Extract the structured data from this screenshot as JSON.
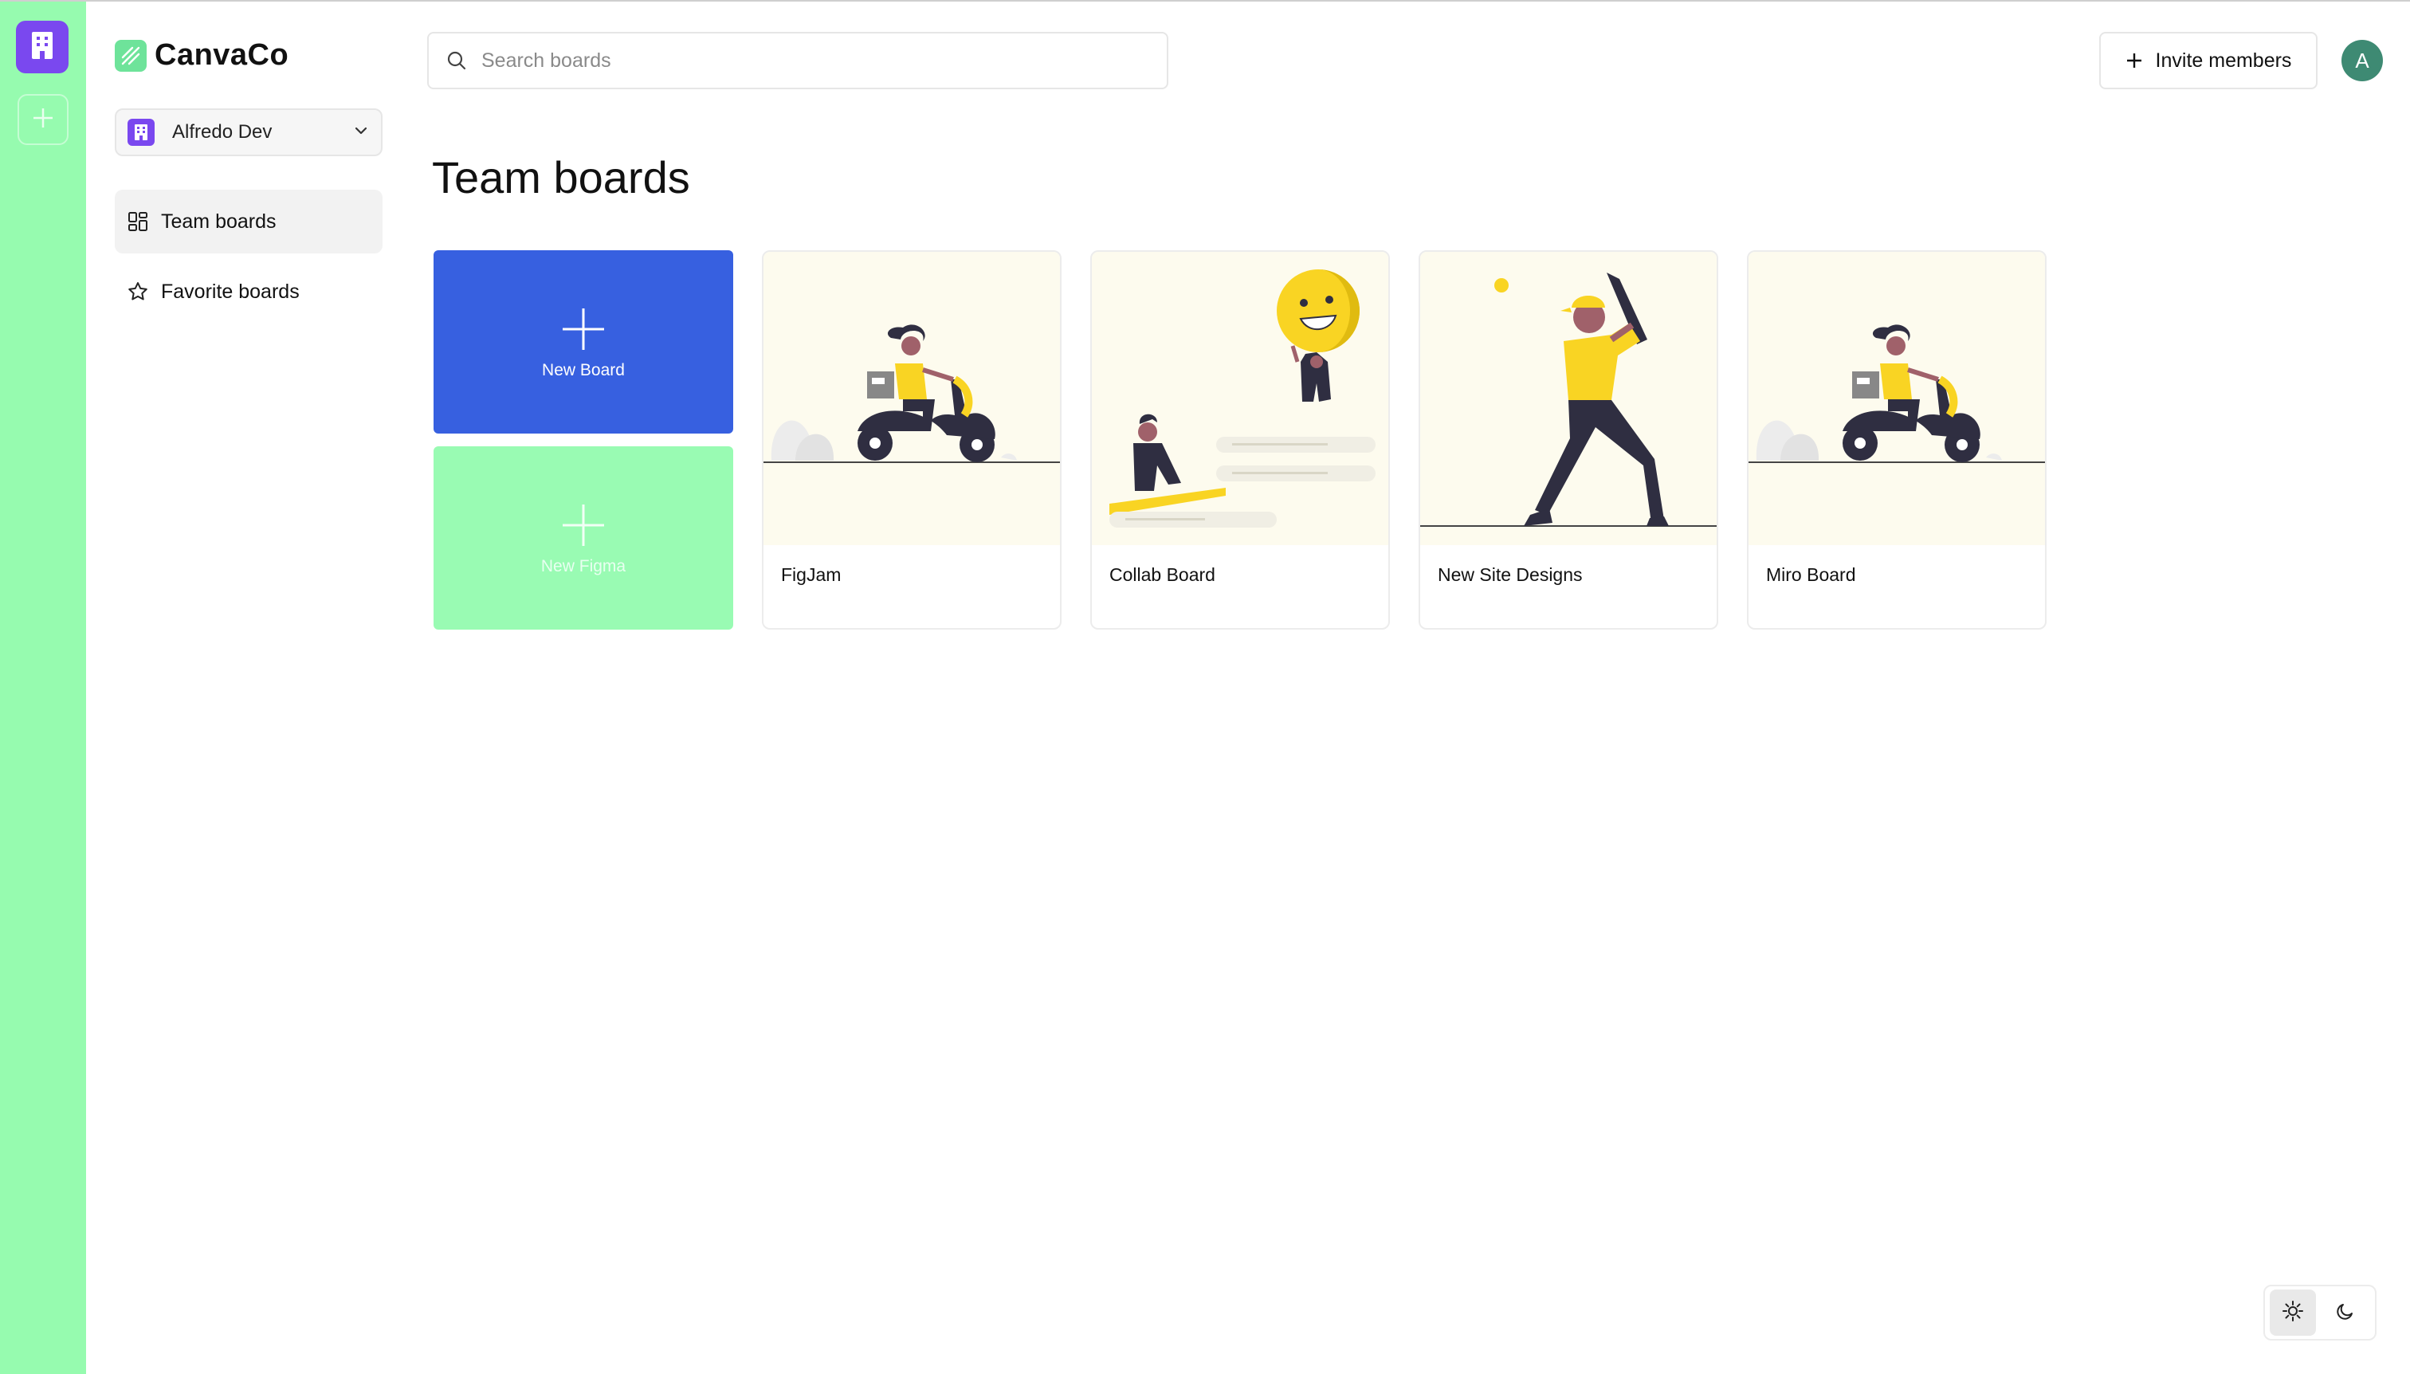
{
  "app": {
    "name": "CanvaCo",
    "accent_color": "#96fbaf",
    "org_color": "#7a48ef"
  },
  "rail": {
    "org_icon": "building-icon",
    "add_icon": "plus-icon"
  },
  "sidebar": {
    "org_switcher": {
      "label": "Alfredo Dev",
      "icon": "building-icon",
      "chevron": "chevron-down-icon"
    },
    "items": [
      {
        "label": "Team boards",
        "icon": "dashboard-icon",
        "active": true
      },
      {
        "label": "Favorite boards",
        "icon": "star-icon",
        "active": false
      }
    ]
  },
  "header": {
    "search": {
      "placeholder": "Search boards",
      "value": "",
      "icon": "search-icon"
    },
    "invite": {
      "label": "Invite members",
      "icon": "plus-icon"
    },
    "user": {
      "initial": "A",
      "color": "#3e8a73"
    }
  },
  "main": {
    "title": "Team boards",
    "actions": [
      {
        "label": "New Board",
        "icon": "plus-icon",
        "color": "#3760e0"
      },
      {
        "label": "New Figma",
        "icon": "plus-icon",
        "color": "#99fbb3"
      }
    ],
    "boards": [
      {
        "title": "FigJam",
        "thumbnail": "scooter-illustration"
      },
      {
        "title": "Collab Board",
        "thumbnail": "collaboration-illustration"
      },
      {
        "title": "New Site Designs",
        "thumbnail": "baseball-illustration"
      },
      {
        "title": "Miro Board",
        "thumbnail": "scooter-illustration"
      }
    ]
  },
  "theme_toggle": {
    "options": [
      {
        "icon": "sun-icon",
        "selected": true
      },
      {
        "icon": "moon-icon",
        "selected": false
      }
    ]
  }
}
